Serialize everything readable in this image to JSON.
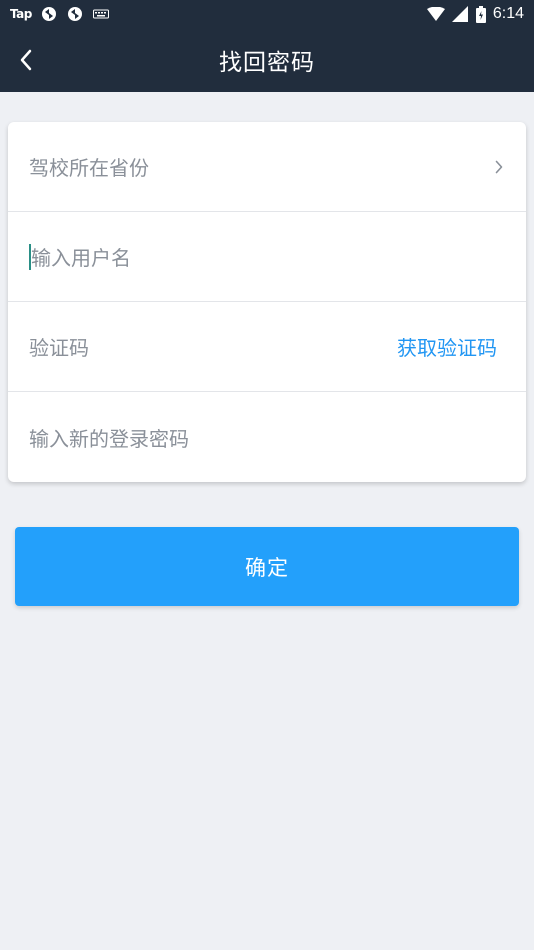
{
  "status_bar": {
    "tap_label": "Tap",
    "time": "6:14",
    "icons": [
      "tap-icon",
      "sync-icon",
      "sync-icon",
      "keyboard-icon",
      "wifi-icon",
      "signal-icon",
      "battery-icon"
    ]
  },
  "header": {
    "title": "找回密码",
    "back_icon": "chevron-left-icon"
  },
  "form": {
    "province_label": "驾校所在省份",
    "username_placeholder": "输入用户名",
    "code_placeholder": "验证码",
    "get_code_label": "获取验证码",
    "new_password_placeholder": "输入新的登录密码"
  },
  "confirm_button": {
    "label": "确定"
  },
  "colors": {
    "header_bg": "#212d3d",
    "page_bg": "#eef0f4",
    "accent": "#2196f3",
    "button_bg": "#23a0fb",
    "placeholder_text": "#8a9099"
  }
}
